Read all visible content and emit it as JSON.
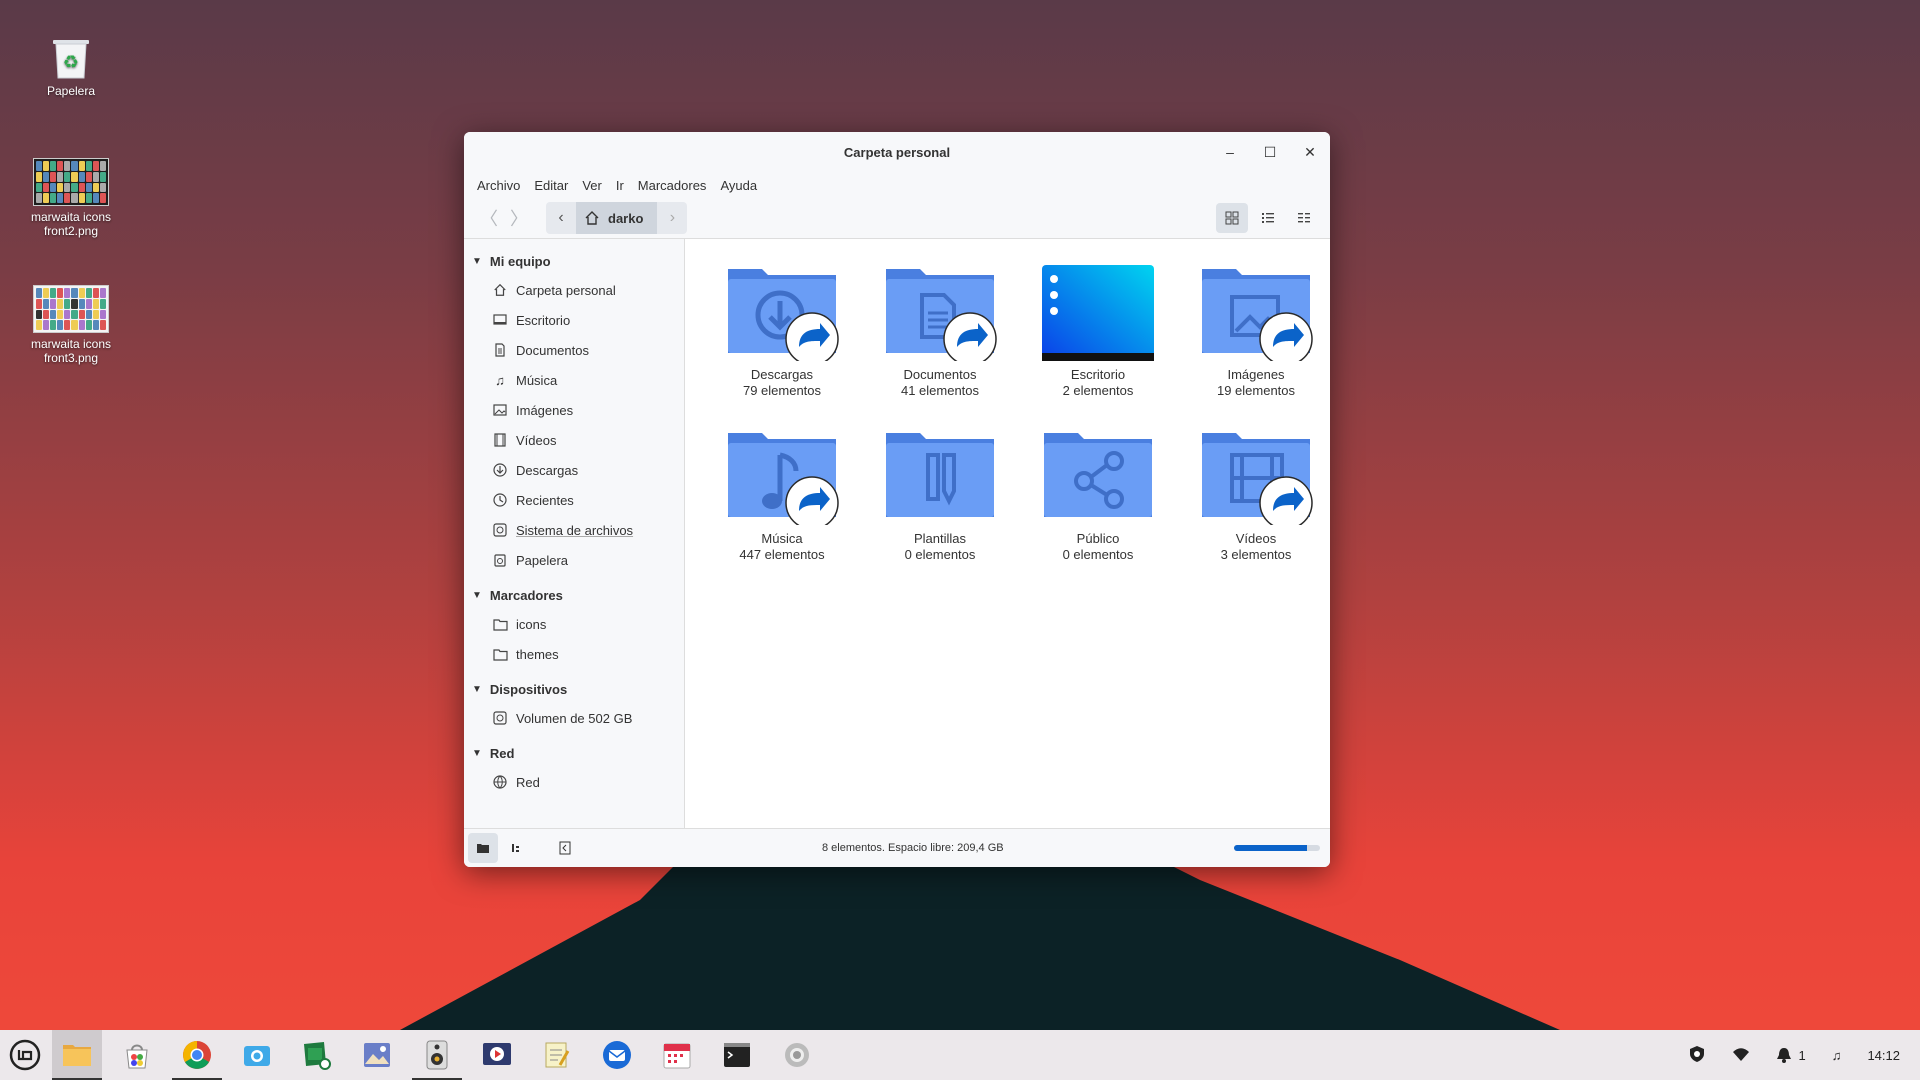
{
  "desktop": {
    "icons": [
      {
        "label": "Papelera"
      },
      {
        "label": "marwaita icons front2.png"
      },
      {
        "label": "marwaita icons front3.png"
      }
    ]
  },
  "window": {
    "title": "Carpeta personal",
    "menu": [
      "Archivo",
      "Editar",
      "Ver",
      "Ir",
      "Marcadores",
      "Ayuda"
    ],
    "breadcrumb": {
      "current": "darko"
    },
    "sidebar": {
      "sections": [
        {
          "title": "Mi equipo",
          "items": [
            {
              "label": "Carpeta personal",
              "icon": "home-icon"
            },
            {
              "label": "Escritorio",
              "icon": "desktop-icon"
            },
            {
              "label": "Documentos",
              "icon": "document-icon"
            },
            {
              "label": "Música",
              "icon": "music-icon"
            },
            {
              "label": "Imágenes",
              "icon": "image-icon"
            },
            {
              "label": "Vídeos",
              "icon": "video-icon"
            },
            {
              "label": "Descargas",
              "icon": "download-icon"
            },
            {
              "label": "Recientes",
              "icon": "recent-icon"
            },
            {
              "label": "Sistema de archivos",
              "icon": "drive-icon"
            },
            {
              "label": "Papelera",
              "icon": "trash-icon"
            }
          ]
        },
        {
          "title": "Marcadores",
          "items": [
            {
              "label": "icons",
              "icon": "folder-icon"
            },
            {
              "label": "themes",
              "icon": "folder-icon"
            }
          ]
        },
        {
          "title": "Dispositivos",
          "items": [
            {
              "label": "Volumen de 502 GB",
              "icon": "drive-icon"
            }
          ]
        },
        {
          "title": "Red",
          "items": [
            {
              "label": "Red",
              "icon": "network-icon"
            }
          ]
        }
      ]
    },
    "files": [
      {
        "name": "Descargas",
        "count": "79 elementos",
        "icon": "download-folder-icon"
      },
      {
        "name": "Documentos",
        "count": "41 elementos",
        "icon": "documents-folder-icon"
      },
      {
        "name": "Escritorio",
        "count": "2 elementos",
        "icon": "desktop-folder-icon"
      },
      {
        "name": "Imágenes",
        "count": "19 elementos",
        "icon": "pictures-folder-icon"
      },
      {
        "name": "Música",
        "count": "447 elementos",
        "icon": "music-folder-icon"
      },
      {
        "name": "Plantillas",
        "count": "0 elementos",
        "icon": "templates-folder-icon"
      },
      {
        "name": "Público",
        "count": "0 elementos",
        "icon": "public-folder-icon"
      },
      {
        "name": "Vídeos",
        "count": "3 elementos",
        "icon": "videos-folder-icon"
      }
    ],
    "status": {
      "text": "8 elementos. Espacio libre: 209,4 GB",
      "usage_fraction": 0.85
    }
  },
  "taskbar": {
    "apps": [
      "menu-icon",
      "files-icon",
      "software-icon",
      "chrome-icon",
      "camera-icon",
      "sheets-icon",
      "image-viewer-icon",
      "audio-icon",
      "video-icon",
      "notes-icon",
      "thunderbird-icon",
      "calendar-icon",
      "terminal-icon",
      "settings-icon"
    ],
    "tray": {
      "notifications": "1",
      "clock": "14:12"
    }
  },
  "colors": {
    "folder": "#5b8ff0",
    "accent": "#0b63c9"
  }
}
